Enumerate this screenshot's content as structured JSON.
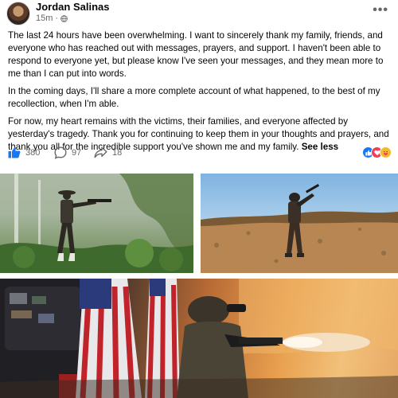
{
  "post": {
    "author": "Jordan Salinas",
    "time": "15m",
    "separator": "·",
    "more_label": "•••",
    "paragraphs": [
      "The last 24 hours have been overwhelming. I want to sincerely thank my family, friends, and everyone who has reached out with messages, prayers, and support. I haven't been able to respond to everyone yet, but please know I've seen your messages, and they mean more to me than I can put into words.",
      "In the coming days, I'll share a more complete account of what happened, to the best of my recollection, when I'm able.",
      "For now, my heart remains with the victims, their families, and everyone affected by yesterday's tragedy. Thank you for continuing to keep them in your thoughts and prayers, and thank you all for the incredible support you've shown me and my family."
    ],
    "see_less": "See less"
  },
  "stats": {
    "likes": "380",
    "comments": "97",
    "shares": "18"
  },
  "icons": {
    "like": "thumbs-up-icon",
    "comment": "comment-bubble-icon",
    "share": "share-arrow-icon",
    "globe": "globe-icon",
    "more": "ellipsis-icon"
  },
  "colors": {
    "like_blue": "#1877f2",
    "love_red": "#f33e58",
    "care_yellow": "#f7b928",
    "meta_gray": "#65676b"
  }
}
